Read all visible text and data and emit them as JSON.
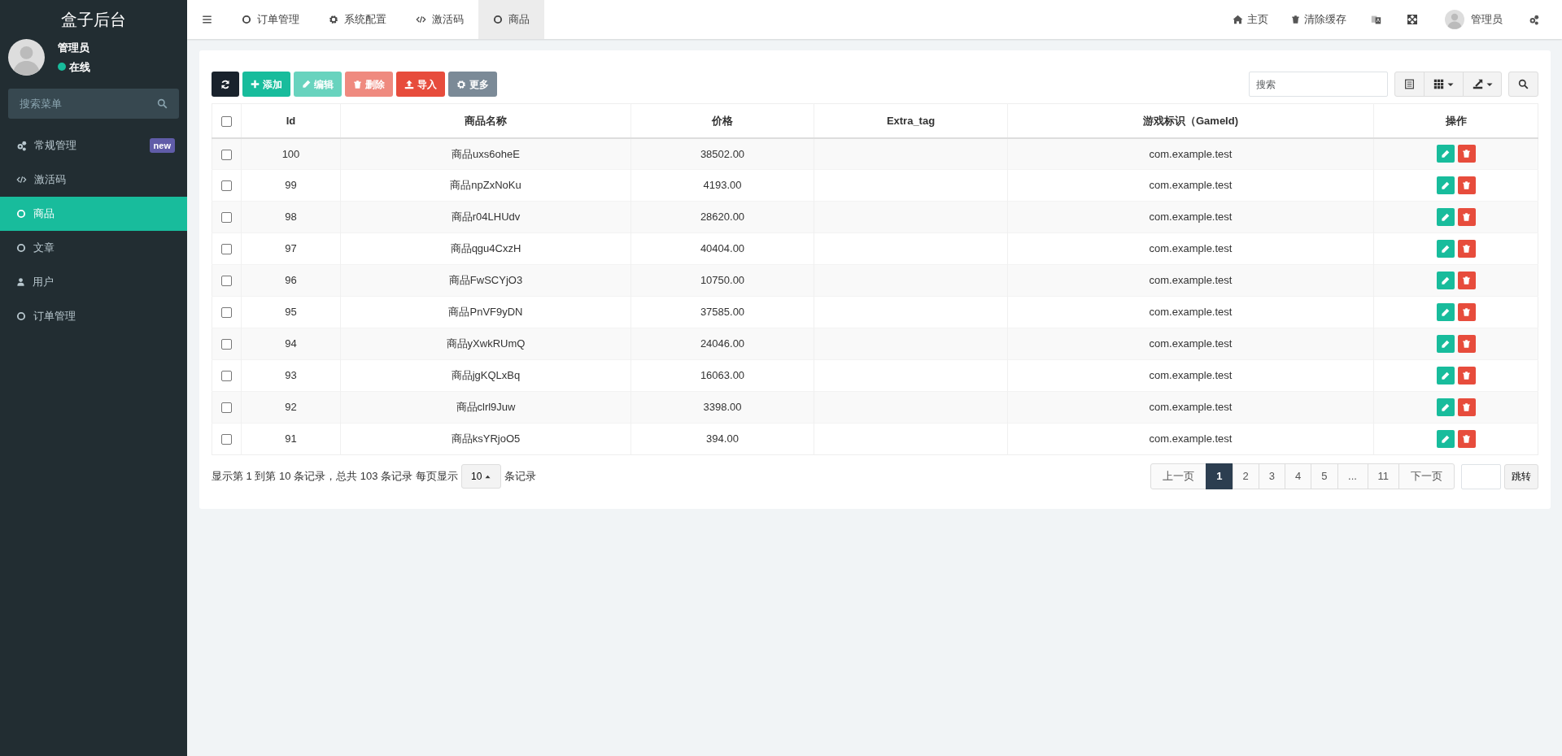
{
  "sidebar": {
    "logo": "盒子后台",
    "user": {
      "name": "管理员",
      "status": "在线",
      "online": true
    },
    "search": {
      "placeholder": "搜索菜单"
    },
    "items": [
      {
        "label": "常规管理",
        "badge": "new",
        "selected": false
      },
      {
        "label": "激活码",
        "selected": false
      },
      {
        "label": "商品",
        "selected": true
      },
      {
        "label": "文章",
        "selected": false
      },
      {
        "label": "用户",
        "selected": false
      },
      {
        "label": "订单管理",
        "selected": false
      }
    ]
  },
  "topbar": {
    "tabs": [
      {
        "label": "订单管理",
        "selected": false
      },
      {
        "label": "系统配置",
        "selected": false
      },
      {
        "label": "激活码",
        "selected": false
      },
      {
        "label": "商品",
        "selected": true
      }
    ],
    "links": [
      {
        "label": "主页"
      },
      {
        "label": "清除缓存"
      }
    ],
    "user": "管理员"
  },
  "toolbar": {
    "buttons": [
      {
        "kind": "refresh",
        "disabled": false
      },
      {
        "kind": "add",
        "label": "添加",
        "disabled": false
      },
      {
        "kind": "edit",
        "label": "编辑",
        "disabled": true
      },
      {
        "kind": "delete",
        "label": "删除",
        "disabled": true
      },
      {
        "kind": "import",
        "label": "导入",
        "disabled": false
      },
      {
        "kind": "more",
        "label": "更多",
        "disabled": false
      }
    ],
    "search": {
      "placeholder": "搜索"
    }
  },
  "table": {
    "columns": [
      "Id",
      "商品名称",
      "价格",
      "Extra_tag",
      "游戏标识（GameId)",
      "操作"
    ],
    "all_checked": false,
    "rows": [
      {
        "checked": false,
        "id": "100",
        "name": "商品uxs6oheE",
        "price": "38502.00",
        "game_id": "com.example.test"
      },
      {
        "checked": false,
        "id": "99",
        "name": "商品npZxNoKu",
        "price": "4193.00",
        "game_id": "com.example.test"
      },
      {
        "checked": false,
        "id": "98",
        "name": "商品r04LHUdv",
        "price": "28620.00",
        "game_id": "com.example.test"
      },
      {
        "checked": false,
        "id": "97",
        "name": "商品qgu4CxzH",
        "price": "40404.00",
        "game_id": "com.example.test"
      },
      {
        "checked": false,
        "id": "96",
        "name": "商品FwSCYjO3",
        "price": "10750.00",
        "game_id": "com.example.test"
      },
      {
        "checked": false,
        "id": "95",
        "name": "商品PnVF9yDN",
        "price": "37585.00",
        "game_id": "com.example.test"
      },
      {
        "checked": false,
        "id": "94",
        "name": "商品yXwkRUmQ",
        "price": "24046.00",
        "game_id": "com.example.test"
      },
      {
        "checked": false,
        "id": "93",
        "name": "商品jgKQLxBq",
        "price": "16063.00",
        "game_id": "com.example.test"
      },
      {
        "checked": false,
        "id": "92",
        "name": "商品clrl9Juw",
        "price": "3398.00",
        "game_id": "com.example.test"
      },
      {
        "checked": false,
        "id": "91",
        "name": "商品ksYRjoO5",
        "price": "394.00",
        "game_id": "com.example.test"
      }
    ]
  },
  "footer": {
    "summary": "显示第 1 到第 10 条记录，总共 103 条记录 每页显示",
    "page_size": "10",
    "suffix": "条记录"
  },
  "pagination": {
    "prev": "上一页",
    "pages": [
      {
        "label": "1",
        "selected": true
      },
      {
        "label": "2",
        "selected": false
      },
      {
        "label": "3",
        "selected": false
      },
      {
        "label": "4",
        "selected": false
      },
      {
        "label": "5",
        "selected": false
      },
      {
        "label": "...",
        "selected": false
      },
      {
        "label": "11",
        "selected": false
      }
    ],
    "next": "下一页",
    "jump": "跳转"
  }
}
